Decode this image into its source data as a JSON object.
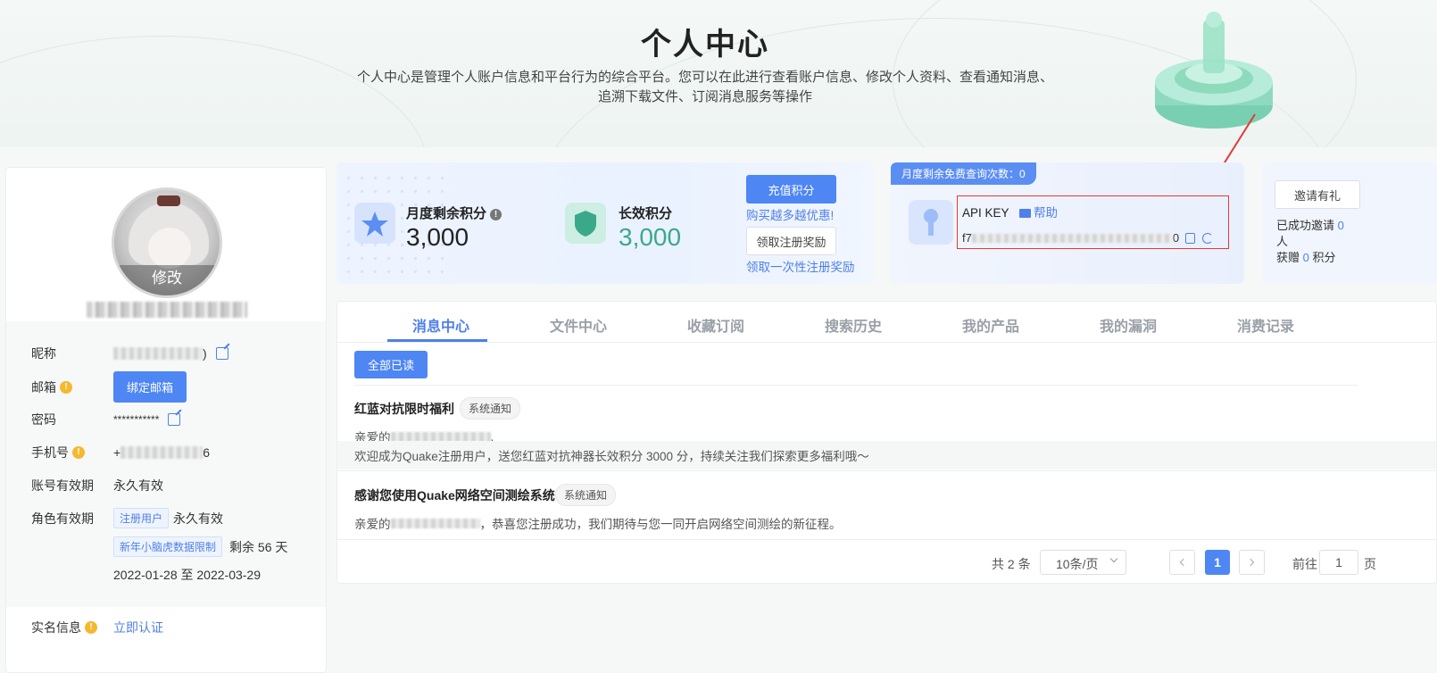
{
  "header": {
    "title": "个人中心",
    "desc_line1": "个人中心是管理个人账户信息和平台行为的综合平台。您可以在此进行查看账户信息、修改个人资料、查看通知消息、",
    "desc_line2": "追溯下载文件、订阅消息服务等操作"
  },
  "profile": {
    "avatar_edit": "修改",
    "fields": {
      "nickname_label": "昵称",
      "nickname_tail": ")",
      "email_label": "邮箱",
      "email_button": "绑定邮箱",
      "password_label": "密码",
      "password_value": "***********",
      "phone_label": "手机号",
      "phone_prefix": "+",
      "phone_suffix": "6",
      "account_validity_label": "账号有效期",
      "account_validity_value": "永久有效",
      "role_validity_label": "角色有效期",
      "role_tag": "注册用户",
      "role_value": "永久有效",
      "limit_tag": "新年小脑虎数据限制",
      "limit_remaining": "剩余 56 天",
      "limit_range": "2022-01-28 至 2022-03-29",
      "realname_label": "实名信息",
      "realname_link": "立即认证"
    }
  },
  "scores": {
    "monthly_label": "月度剩余积分",
    "monthly_value": "3,000",
    "longterm_label": "长效积分",
    "longterm_value": "3,000",
    "recharge_button": "充值积分",
    "promo_link": "购买越多越优惠!",
    "claim_button": "领取注册奖励",
    "claim_link": "领取一次性注册奖励"
  },
  "api": {
    "free_badge": "月度剩余免费查询次数：0",
    "title": "API KEY",
    "help": "帮助",
    "key_prefix": "f7",
    "key_suffix": "0"
  },
  "invite": {
    "button": "邀请有礼",
    "success_prefix": "已成功邀请",
    "success_count": "0",
    "success_unit": "人",
    "earned_prefix": "获赠",
    "earned_count": "0",
    "earned_unit": "积分"
  },
  "tabs": [
    "消息中心",
    "文件中心",
    "收藏订阅",
    "搜索历史",
    "我的产品",
    "我的漏洞",
    "消费记录"
  ],
  "messages": {
    "mark_all_read": "全部已读",
    "items": [
      {
        "title": "红蓝对抗限时福利",
        "tag": "系统通知",
        "greeting_prefix": "亲爱的",
        "greeting_suffix": ",",
        "body": "欢迎成为Quake注册用户，送您红蓝对抗神器长效积分 3000 分，持续关注我们探索更多福利哦～"
      },
      {
        "title": "感谢您使用Quake网络空间测绘系统",
        "tag": "系统通知",
        "greeting_prefix": "亲爱的",
        "body": "，恭喜您注册成功，我们期待与您一同开启网络空间测绘的新征程。"
      }
    ]
  },
  "pagination": {
    "total": "共 2 条",
    "page_size": "10条/页",
    "current_page": "1",
    "goto_label": "前往",
    "goto_value": "1",
    "goto_unit": "页"
  },
  "colors": {
    "primary": "#4e86f4",
    "highlight": "#e53935",
    "teal": "#3aa98a"
  }
}
